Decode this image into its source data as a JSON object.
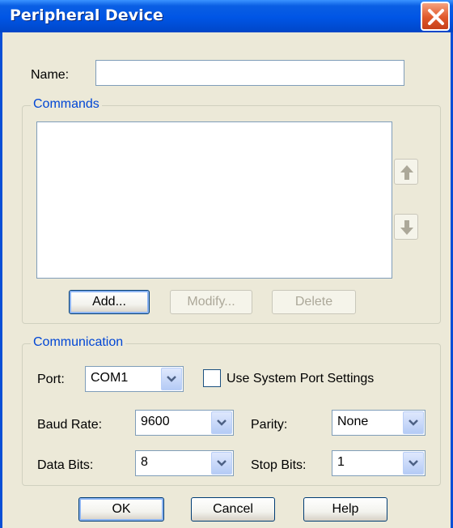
{
  "window": {
    "title": "Peripheral Device"
  },
  "name_field": {
    "label": "Name:",
    "value": ""
  },
  "commands": {
    "group_title": "Commands",
    "items": [],
    "add_label": "Add...",
    "modify_label": "Modify...",
    "delete_label": "Delete"
  },
  "communication": {
    "group_title": "Communication",
    "port_label": "Port:",
    "port_value": "COM1",
    "use_system_label": "Use System Port Settings",
    "baud_label": "Baud Rate:",
    "baud_value": "9600",
    "parity_label": "Parity:",
    "parity_value": "None",
    "data_bits_label": "Data Bits:",
    "data_bits_value": "8",
    "stop_bits_label": "Stop Bits:",
    "stop_bits_value": "1"
  },
  "footer": {
    "ok_label": "OK",
    "cancel_label": "Cancel",
    "help_label": "Help"
  },
  "colors": {
    "title_bar": "#0055e5",
    "group_title": "#0046d5",
    "close": "#e0582a"
  }
}
